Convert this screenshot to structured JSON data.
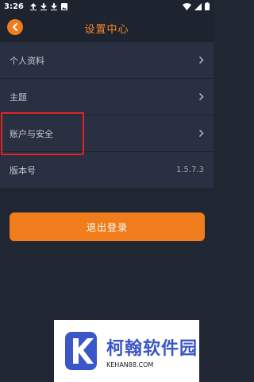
{
  "status_bar": {
    "time": "3:26",
    "left_icons": [
      "upload-icon",
      "download-icon",
      "download-icon",
      "image-icon"
    ],
    "right_icons": [
      "wifi-icon",
      "signal-icon",
      "battery-icon"
    ]
  },
  "header": {
    "title": "设置中心",
    "back_icon": "chevron-left-icon"
  },
  "menu": {
    "profile_label": "个人资料",
    "topic_label": "主题",
    "account_label": "账户与安全",
    "version_label": "版本号",
    "version_value": "1.5.7.3"
  },
  "logout": {
    "label": "退出登录"
  },
  "watermark": {
    "title": "柯翰软件园",
    "subtitle": "KEHAN88.COM"
  },
  "colors": {
    "background": "#212633",
    "row": "#293041",
    "accent": "#f07c1c",
    "highlight": "#e02424"
  }
}
